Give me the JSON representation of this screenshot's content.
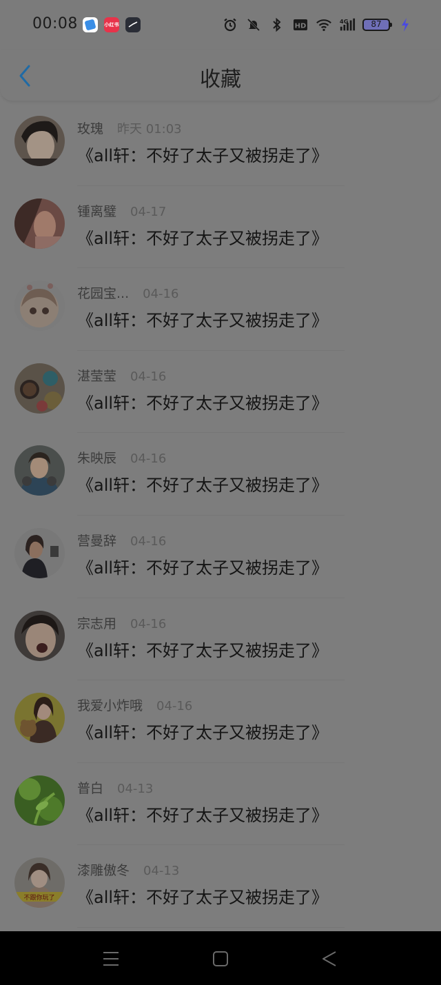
{
  "status_bar": {
    "time": "00:08",
    "app_icons": [
      "blue-app-icon",
      "red-app-icon",
      "dark-app-icon"
    ],
    "battery_level": "87",
    "network": "4G"
  },
  "header": {
    "title": "收藏"
  },
  "items": [
    {
      "username": "玫⁠瑰",
      "time": "昨天 01:03",
      "title": "《all轩：不好了太子又被拐走了》"
    },
    {
      "username": "锺离璧",
      "time": "04-17",
      "title": "《all轩：不好了太子又被拐走了》"
    },
    {
      "username": "花园宝...",
      "time": "04-16",
      "title": "《all轩：不好了太子又被拐走了》"
    },
    {
      "username": "湛莹莹",
      "time": "04-16",
      "title": "《all轩：不好了太子又被拐走了》"
    },
    {
      "username": "朱映辰",
      "time": "04-16",
      "title": "《all轩：不好了太子又被拐走了》"
    },
    {
      "username": "营曼辞",
      "time": "04-16",
      "title": "《all轩：不好了太子又被拐走了》"
    },
    {
      "username": "宗志用",
      "time": "04-16",
      "title": "《all轩：不好了太子又被拐走了》"
    },
    {
      "username": "我爱小炸哦",
      "time": "04-16",
      "title": "《all轩：不好了太子又被拐走了》"
    },
    {
      "username": "普白",
      "time": "04-13",
      "title": "《all轩：不好了太子又被拐走了》"
    },
    {
      "username": "漆雕傲冬",
      "time": "04-13",
      "title": "《all轩：不好了太子又被拐走了》"
    }
  ],
  "avatar_badge_text": "不跟你玩了",
  "colors": {
    "accent": "#1f6aa5",
    "overlay": "#7d7d7d"
  }
}
